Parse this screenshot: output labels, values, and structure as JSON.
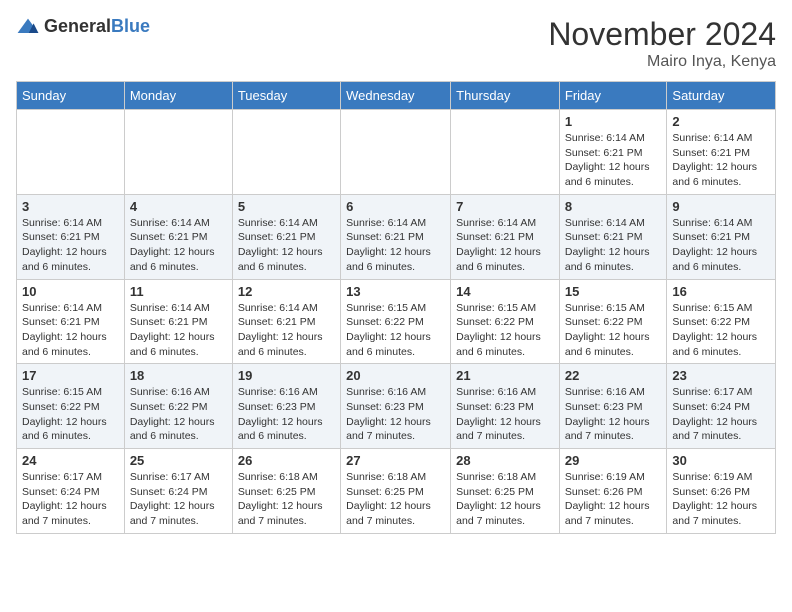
{
  "logo": {
    "text_general": "General",
    "text_blue": "Blue"
  },
  "header": {
    "month_title": "November 2024",
    "location": "Mairo Inya, Kenya"
  },
  "weekdays": [
    "Sunday",
    "Monday",
    "Tuesday",
    "Wednesday",
    "Thursday",
    "Friday",
    "Saturday"
  ],
  "weeks": [
    [
      {
        "day": "",
        "info": ""
      },
      {
        "day": "",
        "info": ""
      },
      {
        "day": "",
        "info": ""
      },
      {
        "day": "",
        "info": ""
      },
      {
        "day": "",
        "info": ""
      },
      {
        "day": "1",
        "info": "Sunrise: 6:14 AM\nSunset: 6:21 PM\nDaylight: 12 hours and 6 minutes."
      },
      {
        "day": "2",
        "info": "Sunrise: 6:14 AM\nSunset: 6:21 PM\nDaylight: 12 hours and 6 minutes."
      }
    ],
    [
      {
        "day": "3",
        "info": "Sunrise: 6:14 AM\nSunset: 6:21 PM\nDaylight: 12 hours and 6 minutes."
      },
      {
        "day": "4",
        "info": "Sunrise: 6:14 AM\nSunset: 6:21 PM\nDaylight: 12 hours and 6 minutes."
      },
      {
        "day": "5",
        "info": "Sunrise: 6:14 AM\nSunset: 6:21 PM\nDaylight: 12 hours and 6 minutes."
      },
      {
        "day": "6",
        "info": "Sunrise: 6:14 AM\nSunset: 6:21 PM\nDaylight: 12 hours and 6 minutes."
      },
      {
        "day": "7",
        "info": "Sunrise: 6:14 AM\nSunset: 6:21 PM\nDaylight: 12 hours and 6 minutes."
      },
      {
        "day": "8",
        "info": "Sunrise: 6:14 AM\nSunset: 6:21 PM\nDaylight: 12 hours and 6 minutes."
      },
      {
        "day": "9",
        "info": "Sunrise: 6:14 AM\nSunset: 6:21 PM\nDaylight: 12 hours and 6 minutes."
      }
    ],
    [
      {
        "day": "10",
        "info": "Sunrise: 6:14 AM\nSunset: 6:21 PM\nDaylight: 12 hours and 6 minutes."
      },
      {
        "day": "11",
        "info": "Sunrise: 6:14 AM\nSunset: 6:21 PM\nDaylight: 12 hours and 6 minutes."
      },
      {
        "day": "12",
        "info": "Sunrise: 6:14 AM\nSunset: 6:21 PM\nDaylight: 12 hours and 6 minutes."
      },
      {
        "day": "13",
        "info": "Sunrise: 6:15 AM\nSunset: 6:22 PM\nDaylight: 12 hours and 6 minutes."
      },
      {
        "day": "14",
        "info": "Sunrise: 6:15 AM\nSunset: 6:22 PM\nDaylight: 12 hours and 6 minutes."
      },
      {
        "day": "15",
        "info": "Sunrise: 6:15 AM\nSunset: 6:22 PM\nDaylight: 12 hours and 6 minutes."
      },
      {
        "day": "16",
        "info": "Sunrise: 6:15 AM\nSunset: 6:22 PM\nDaylight: 12 hours and 6 minutes."
      }
    ],
    [
      {
        "day": "17",
        "info": "Sunrise: 6:15 AM\nSunset: 6:22 PM\nDaylight: 12 hours and 6 minutes."
      },
      {
        "day": "18",
        "info": "Sunrise: 6:16 AM\nSunset: 6:22 PM\nDaylight: 12 hours and 6 minutes."
      },
      {
        "day": "19",
        "info": "Sunrise: 6:16 AM\nSunset: 6:23 PM\nDaylight: 12 hours and 6 minutes."
      },
      {
        "day": "20",
        "info": "Sunrise: 6:16 AM\nSunset: 6:23 PM\nDaylight: 12 hours and 7 minutes."
      },
      {
        "day": "21",
        "info": "Sunrise: 6:16 AM\nSunset: 6:23 PM\nDaylight: 12 hours and 7 minutes."
      },
      {
        "day": "22",
        "info": "Sunrise: 6:16 AM\nSunset: 6:23 PM\nDaylight: 12 hours and 7 minutes."
      },
      {
        "day": "23",
        "info": "Sunrise: 6:17 AM\nSunset: 6:24 PM\nDaylight: 12 hours and 7 minutes."
      }
    ],
    [
      {
        "day": "24",
        "info": "Sunrise: 6:17 AM\nSunset: 6:24 PM\nDaylight: 12 hours and 7 minutes."
      },
      {
        "day": "25",
        "info": "Sunrise: 6:17 AM\nSunset: 6:24 PM\nDaylight: 12 hours and 7 minutes."
      },
      {
        "day": "26",
        "info": "Sunrise: 6:18 AM\nSunset: 6:25 PM\nDaylight: 12 hours and 7 minutes."
      },
      {
        "day": "27",
        "info": "Sunrise: 6:18 AM\nSunset: 6:25 PM\nDaylight: 12 hours and 7 minutes."
      },
      {
        "day": "28",
        "info": "Sunrise: 6:18 AM\nSunset: 6:25 PM\nDaylight: 12 hours and 7 minutes."
      },
      {
        "day": "29",
        "info": "Sunrise: 6:19 AM\nSunset: 6:26 PM\nDaylight: 12 hours and 7 minutes."
      },
      {
        "day": "30",
        "info": "Sunrise: 6:19 AM\nSunset: 6:26 PM\nDaylight: 12 hours and 7 minutes."
      }
    ]
  ]
}
